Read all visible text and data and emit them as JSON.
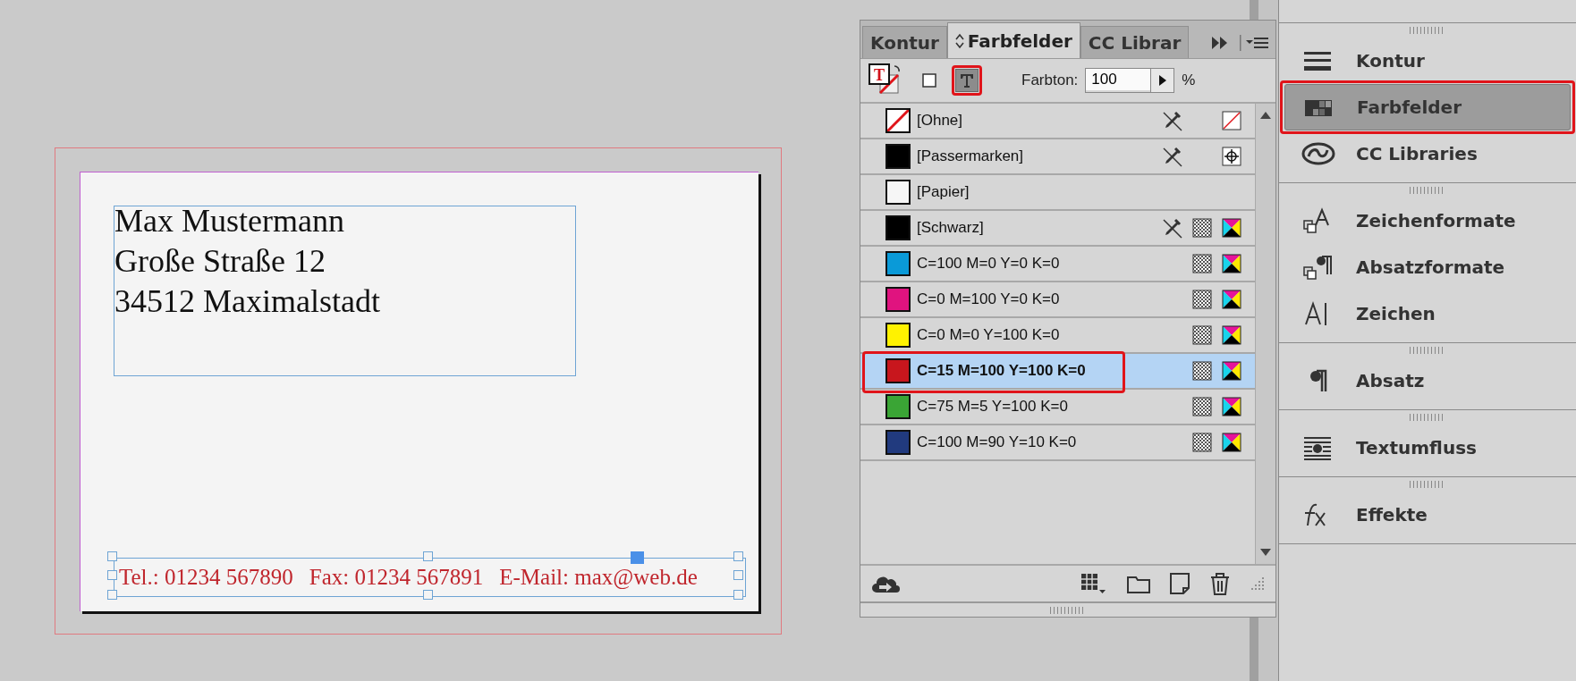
{
  "document": {
    "address_lines": [
      "Max Mustermann",
      "Große Straße 12",
      "34512 Maximalstadt"
    ],
    "contact_items": [
      "Tel.: 01234 567890",
      "Fax: 01234 567891",
      "E-Mail: max@web.de"
    ]
  },
  "panel": {
    "tabs": [
      {
        "label": "Kontur",
        "selected": false
      },
      {
        "label": "Farbfelder",
        "selected": true
      },
      {
        "label": "CC Librar",
        "selected": false
      }
    ],
    "fill_stroke_glyph": "T",
    "format_buttons": [
      {
        "kind": "container",
        "selected": false,
        "highlighted": false
      },
      {
        "kind": "text",
        "selected": true,
        "highlighted": true
      }
    ],
    "tint_label": "Farbton:",
    "tint_value": "100",
    "tint_unit": "%",
    "swatches": [
      {
        "name": "[Ohne]",
        "kind": "none",
        "locked": true,
        "selected": false,
        "highlighted": false
      },
      {
        "name": "[Passermarken]",
        "kind": "registration",
        "color": "#000000",
        "locked": true,
        "selected": false,
        "highlighted": false
      },
      {
        "name": "[Papier]",
        "kind": "paper",
        "color": "#f6f6f6",
        "locked": false,
        "selected": false,
        "highlighted": false
      },
      {
        "name": "[Schwarz]",
        "kind": "process",
        "color": "#000000",
        "locked": true,
        "selected": false,
        "highlighted": false
      },
      {
        "name": "C=100 M=0 Y=0 K=0",
        "kind": "process",
        "color": "#0a9ad8",
        "locked": false,
        "selected": false,
        "highlighted": false
      },
      {
        "name": "C=0 M=100 Y=0 K=0",
        "kind": "process",
        "color": "#e0137f",
        "locked": false,
        "selected": false,
        "highlighted": false
      },
      {
        "name": "C=0 M=0 Y=100 K=0",
        "kind": "process",
        "color": "#fff200",
        "locked": false,
        "selected": false,
        "highlighted": false
      },
      {
        "name": "C=15 M=100 Y=100 K=0",
        "kind": "process",
        "color": "#c8161d",
        "locked": false,
        "selected": true,
        "highlighted": true
      },
      {
        "name": "C=75 M=5 Y=100 K=0",
        "kind": "process",
        "color": "#3aa535",
        "locked": false,
        "selected": false,
        "highlighted": false
      },
      {
        "name": "C=100 M=90 Y=10 K=0",
        "kind": "process",
        "color": "#213a7e",
        "locked": false,
        "selected": false,
        "highlighted": false
      }
    ]
  },
  "dock": {
    "sections": [
      {
        "items": [
          {
            "label": "Kontur",
            "kind": "stroke",
            "selected": false,
            "highlighted": false
          },
          {
            "label": "Farbfelder",
            "kind": "swatches",
            "selected": true,
            "highlighted": true
          },
          {
            "label": "CC Libraries",
            "kind": "libraries",
            "selected": false,
            "highlighted": false
          }
        ]
      },
      {
        "items": [
          {
            "label": "Zeichenformate",
            "kind": "char-styles",
            "selected": false,
            "highlighted": false
          },
          {
            "label": "Absatzformate",
            "kind": "para-styles",
            "selected": false,
            "highlighted": false
          },
          {
            "label": "Zeichen",
            "kind": "character",
            "selected": false,
            "highlighted": false
          }
        ]
      },
      {
        "items": [
          {
            "label": "Absatz",
            "kind": "paragraph",
            "selected": false,
            "highlighted": false
          }
        ]
      },
      {
        "items": [
          {
            "label": "Textumfluss",
            "kind": "wrap",
            "selected": false,
            "highlighted": false
          }
        ]
      },
      {
        "items": [
          {
            "label": "Effekte",
            "kind": "effects",
            "selected": false,
            "highlighted": false
          }
        ]
      }
    ]
  }
}
